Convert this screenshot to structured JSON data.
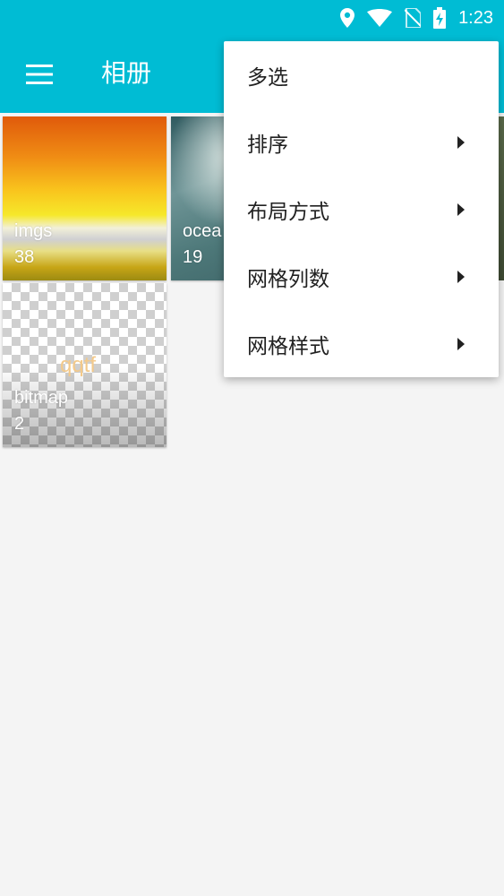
{
  "status_bar": {
    "time": "1:23",
    "icons": [
      "location-icon",
      "wifi-icon",
      "no-sim-icon",
      "battery-charging-icon"
    ]
  },
  "app_bar": {
    "title": "相册",
    "menu_icon": "menu-icon"
  },
  "albums": [
    {
      "name": "imgs",
      "count": "38"
    },
    {
      "name": "ocea",
      "count": "19"
    },
    {
      "name": "bitmap",
      "count": "2",
      "overlay_text": "qqtf"
    }
  ],
  "popup_menu": {
    "items": [
      {
        "label": "多选",
        "has_submenu": false
      },
      {
        "label": "排序",
        "has_submenu": true
      },
      {
        "label": "布局方式",
        "has_submenu": true
      },
      {
        "label": "网格列数",
        "has_submenu": true
      },
      {
        "label": "网格样式",
        "has_submenu": true
      }
    ]
  },
  "colors": {
    "primary": "#00bcd4",
    "background": "#f4f4f4",
    "menu_background": "#ffffff",
    "menu_text": "#212121"
  }
}
